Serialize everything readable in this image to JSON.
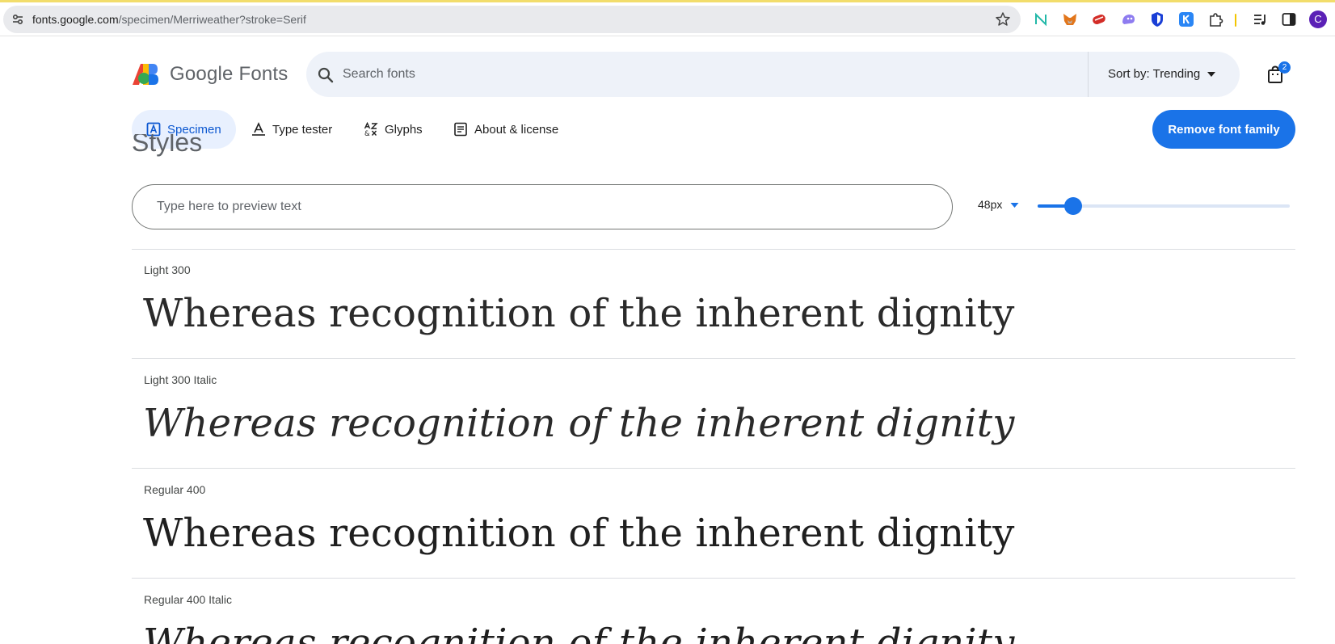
{
  "browser": {
    "url_host": "fonts.google.com",
    "url_path": "/specimen/Merriweather?stroke=Serif",
    "avatar_letter": "C",
    "extensions": [
      "notion-icon",
      "metamask-icon",
      "lastpass-icon",
      "ghost-icon",
      "shield-icon",
      "k-icon",
      "puzzle-icon",
      "media-icon",
      "sidepanel-icon"
    ]
  },
  "header": {
    "logo_text": "Google Fonts",
    "search_placeholder": "Search fonts",
    "sort_label": "Sort by: Trending",
    "cart_count": "2"
  },
  "tabs": [
    {
      "label": "Specimen",
      "active": true
    },
    {
      "label": "Type tester",
      "active": false
    },
    {
      "label": "Glyphs",
      "active": false
    },
    {
      "label": "About & license",
      "active": false
    }
  ],
  "remove_button": "Remove font family",
  "section_heading": "Styles",
  "preview": {
    "placeholder": "Type here to preview text",
    "size_label": "48px",
    "slider_fraction": 0.14
  },
  "styles": [
    {
      "label": "Light 300",
      "sample": "Whereas recognition of the inherent dignity"
    },
    {
      "label": "Light 300 Italic",
      "sample": "Whereas recognition of the inherent dignity"
    },
    {
      "label": "Regular 400",
      "sample": "Whereas recognition of the inherent dignity"
    },
    {
      "label": "Regular 400 Italic",
      "sample": "Whereas recognition of the inherent dignity"
    }
  ],
  "colors": {
    "accent": "#1a73e8",
    "search_bg": "#eef2f9",
    "active_tab_bg": "#e8f0fe"
  }
}
